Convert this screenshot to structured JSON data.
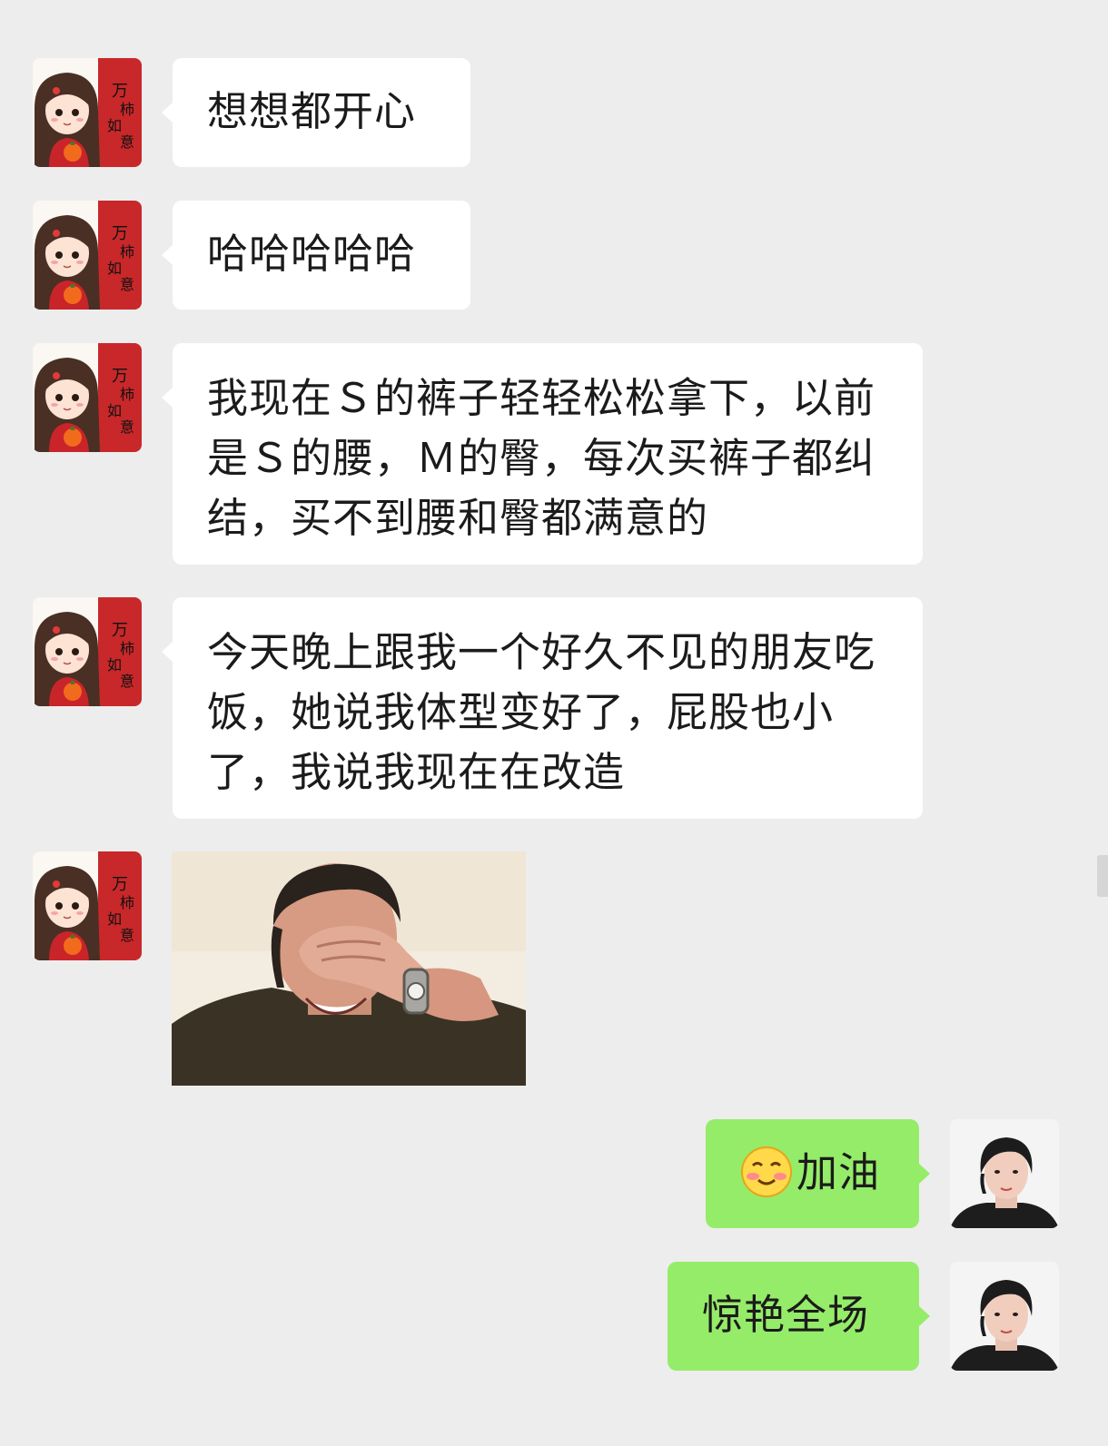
{
  "messages": [
    {
      "side": "left",
      "type": "text",
      "text": "想想都开心"
    },
    {
      "side": "left",
      "type": "text",
      "text": "哈哈哈哈哈"
    },
    {
      "side": "left",
      "type": "text",
      "text": "我现在Ｓ的裤子轻轻松松拿下，以前是Ｓ的腰，Ｍ的臀，每次买裤子都纠结，买不到腰和臀都满意的"
    },
    {
      "side": "left",
      "type": "text",
      "text": "今天晚上跟我一个好久不见的朋友吃饭，她说我体型变好了，屁股也小了，我说我现在在改造"
    },
    {
      "side": "left",
      "type": "sticker",
      "sticker": "man-covering-face-laughing"
    },
    {
      "side": "right",
      "type": "text",
      "emoji": "smiling-blush-emoji",
      "text": "加油"
    },
    {
      "side": "right",
      "type": "text",
      "text": "惊艳全场"
    }
  ],
  "avatar_text": "万柿如意",
  "colors": {
    "background": "#ededed",
    "left_bubble": "#ffffff",
    "right_bubble": "#95ec69",
    "avatar_red": "#c8282a"
  }
}
